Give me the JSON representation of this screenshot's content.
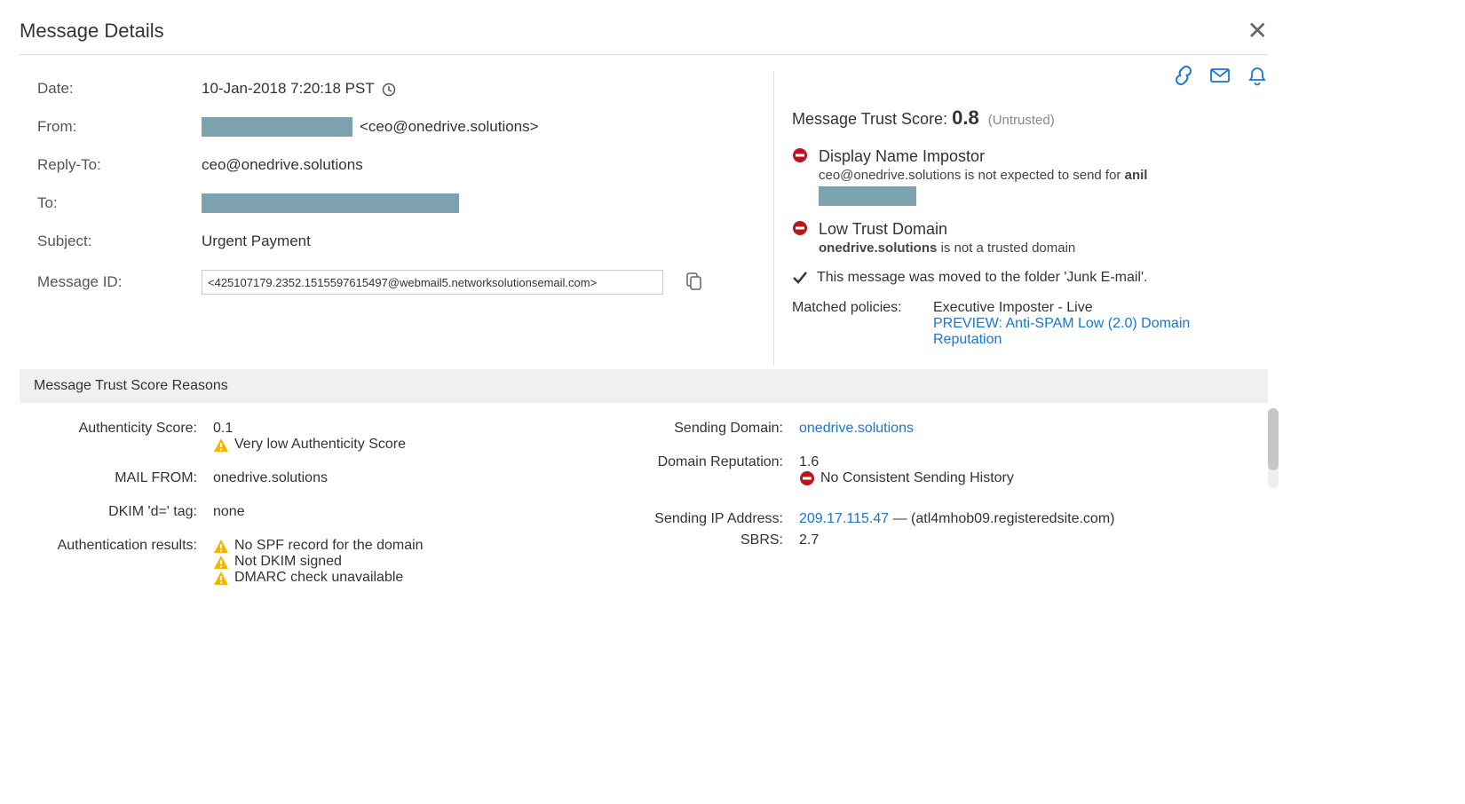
{
  "header": {
    "title": "Message Details"
  },
  "message": {
    "labels": {
      "date": "Date:",
      "from": "From:",
      "reply_to": "Reply-To:",
      "to": "To:",
      "subject": "Subject:",
      "message_id": "Message ID:"
    },
    "date": "10-Jan-2018 7:20:18 PST",
    "from_email": "<ceo@onedrive.solutions>",
    "reply_to": "ceo@onedrive.solutions",
    "subject": "Urgent Payment",
    "message_id": "<425107179.2352.1515597615497@webmail5.networksolutionsemail.com>"
  },
  "trust": {
    "label": "Message Trust Score:",
    "score": "0.8",
    "status": "(Untrusted)",
    "reasons": [
      {
        "title": "Display Name Impostor",
        "desc_pre": "ceo@onedrive.solutions is not expected to send for ",
        "desc_bold": "anil"
      },
      {
        "title": "Low Trust Domain",
        "desc_bold": "onedrive.solutions",
        "desc_post": " is not a trusted domain"
      }
    ],
    "moved_folder": "This message was moved to the folder 'Junk E-mail'.",
    "matched_policies_label": "Matched policies:",
    "policies": {
      "p1": "Executive Imposter - Live",
      "p2": "PREVIEW: Anti-SPAM Low (2.0) Domain Reputation"
    }
  },
  "score_section": {
    "title": "Message Trust Score Reasons"
  },
  "score_reasons": {
    "labels": {
      "authenticity": "Authenticity Score:",
      "mail_from": "MAIL FROM:",
      "dkim_tag": "DKIM 'd=' tag:",
      "auth_results": "Authentication results:",
      "sending_domain": "Sending Domain:",
      "domain_reputation": "Domain Reputation:",
      "sending_ip": "Sending IP Address:",
      "sbrs": "SBRS:"
    },
    "authenticity_score": "0.1",
    "authenticity_warn": "Very low Authenticity Score",
    "mail_from": "onedrive.solutions",
    "dkim_tag": "none",
    "auth_results": {
      "r1": "No SPF record for the domain",
      "r2": "Not DKIM signed",
      "r3": "DMARC check unavailable"
    },
    "sending_domain": "onedrive.solutions",
    "domain_reputation": "1.6",
    "domain_rep_warn": "No Consistent Sending History",
    "sending_ip": "209.17.115.47",
    "sending_ip_host": " — (atl4mhob09.registeredsite.com)",
    "sbrs": "2.7"
  },
  "icons": {
    "link": "link-icon",
    "mail": "mail-icon",
    "bell": "bell-icon",
    "close": "close-icon",
    "clock": "clock-icon",
    "copy": "copy-icon",
    "stop": "stop-icon",
    "check": "check-icon",
    "warn": "warn-icon"
  }
}
